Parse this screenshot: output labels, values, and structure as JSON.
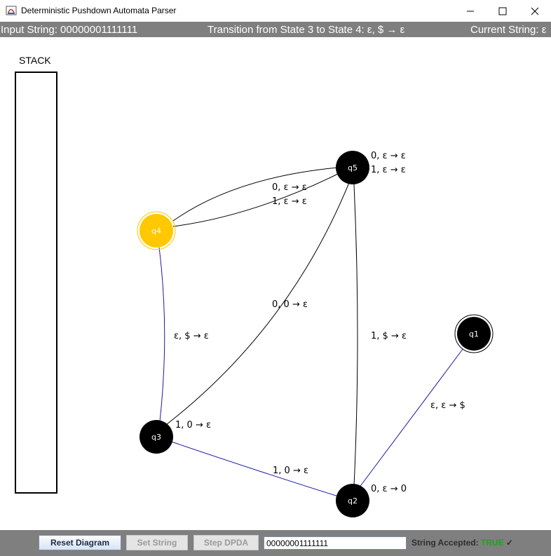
{
  "window": {
    "title": "Deterministic Pushdown Automata Parser",
    "minimize_glyph": "—",
    "maximize_glyph": "☐",
    "close_glyph": "✕"
  },
  "status": {
    "input_string": "Input String: 00000001111111",
    "transition": "Transition from State 3 to State 4: ε, $ → ε",
    "current_string": "Current String: ε"
  },
  "stack": {
    "label": "STACK",
    "items": []
  },
  "diagram": {
    "states": [
      {
        "id": "q1",
        "label": "q1",
        "accepting": true,
        "active": false
      },
      {
        "id": "q2",
        "label": "q2",
        "accepting": false,
        "active": false
      },
      {
        "id": "q3",
        "label": "q3",
        "accepting": false,
        "active": false
      },
      {
        "id": "q4",
        "label": "q4",
        "accepting": true,
        "active": true
      },
      {
        "id": "q5",
        "label": "q5",
        "accepting": false,
        "active": false
      }
    ],
    "transitions": [
      {
        "from": "q1",
        "to": "q2",
        "label": "ε, ε → $",
        "traversed": true
      },
      {
        "from": "q2",
        "to": "q2",
        "label": "0, ε → 0",
        "traversed": false
      },
      {
        "from": "q2",
        "to": "q3",
        "label": "1, 0 → ε",
        "traversed": true
      },
      {
        "from": "q3",
        "to": "q3",
        "label": "1, 0 → ε",
        "traversed": false
      },
      {
        "from": "q3",
        "to": "q4",
        "label": "ε, $ → ε",
        "traversed": true
      },
      {
        "from": "q3",
        "to": "q5",
        "label": "0, 0 → ε",
        "traversed": false
      },
      {
        "from": "q2",
        "to": "q5",
        "label": "1, $ → ε",
        "traversed": false
      },
      {
        "from": "q4",
        "to": "q5",
        "label": "0, ε → ε",
        "traversed": false
      },
      {
        "from": "q5",
        "to": "q4",
        "label": "1, ε → ε",
        "traversed": false
      },
      {
        "from": "q5",
        "to": "q5",
        "label": "0, ε → ε",
        "traversed": false
      },
      {
        "from": "q5",
        "to": "q5",
        "label": "1, ε → ε",
        "traversed": false
      }
    ],
    "colors": {
      "state_fill": "#000000",
      "active_fill": "#ffc800",
      "traversed_edge": "#1a1aa8",
      "edge": "#000000"
    }
  },
  "controls": {
    "reset_label": "Reset Diagram",
    "set_label": "Set String",
    "step_label": "Step DPDA",
    "input_value": "00000001111111",
    "accepted_label": "String Accepted:",
    "accepted_value": "TRUE",
    "accepted_check": "✓"
  }
}
